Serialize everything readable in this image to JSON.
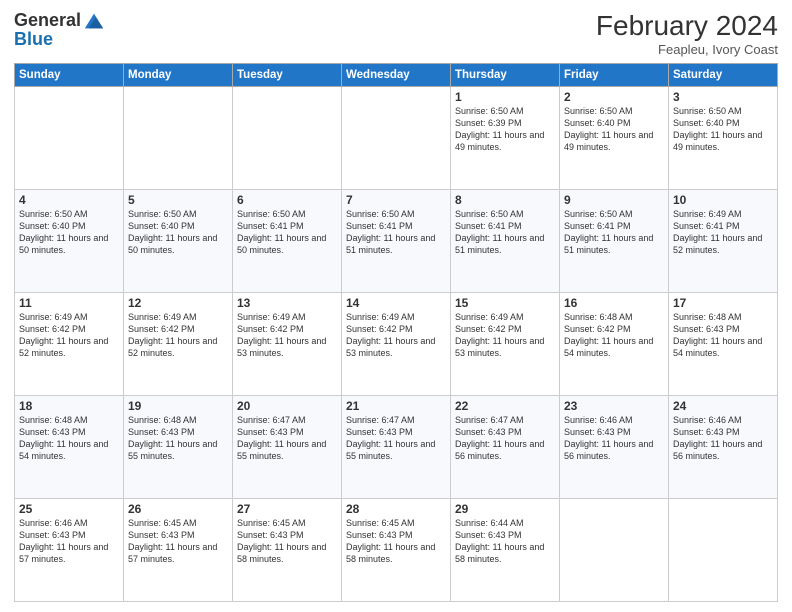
{
  "header": {
    "logo_general": "General",
    "logo_blue": "Blue",
    "month": "February 2024",
    "location": "Feapleu, Ivory Coast"
  },
  "days_of_week": [
    "Sunday",
    "Monday",
    "Tuesday",
    "Wednesday",
    "Thursday",
    "Friday",
    "Saturday"
  ],
  "weeks": [
    [
      {
        "num": "",
        "info": ""
      },
      {
        "num": "",
        "info": ""
      },
      {
        "num": "",
        "info": ""
      },
      {
        "num": "",
        "info": ""
      },
      {
        "num": "1",
        "info": "Sunrise: 6:50 AM\nSunset: 6:39 PM\nDaylight: 11 hours and 49 minutes."
      },
      {
        "num": "2",
        "info": "Sunrise: 6:50 AM\nSunset: 6:40 PM\nDaylight: 11 hours and 49 minutes."
      },
      {
        "num": "3",
        "info": "Sunrise: 6:50 AM\nSunset: 6:40 PM\nDaylight: 11 hours and 49 minutes."
      }
    ],
    [
      {
        "num": "4",
        "info": "Sunrise: 6:50 AM\nSunset: 6:40 PM\nDaylight: 11 hours and 50 minutes."
      },
      {
        "num": "5",
        "info": "Sunrise: 6:50 AM\nSunset: 6:40 PM\nDaylight: 11 hours and 50 minutes."
      },
      {
        "num": "6",
        "info": "Sunrise: 6:50 AM\nSunset: 6:41 PM\nDaylight: 11 hours and 50 minutes."
      },
      {
        "num": "7",
        "info": "Sunrise: 6:50 AM\nSunset: 6:41 PM\nDaylight: 11 hours and 51 minutes."
      },
      {
        "num": "8",
        "info": "Sunrise: 6:50 AM\nSunset: 6:41 PM\nDaylight: 11 hours and 51 minutes."
      },
      {
        "num": "9",
        "info": "Sunrise: 6:50 AM\nSunset: 6:41 PM\nDaylight: 11 hours and 51 minutes."
      },
      {
        "num": "10",
        "info": "Sunrise: 6:49 AM\nSunset: 6:41 PM\nDaylight: 11 hours and 52 minutes."
      }
    ],
    [
      {
        "num": "11",
        "info": "Sunrise: 6:49 AM\nSunset: 6:42 PM\nDaylight: 11 hours and 52 minutes."
      },
      {
        "num": "12",
        "info": "Sunrise: 6:49 AM\nSunset: 6:42 PM\nDaylight: 11 hours and 52 minutes."
      },
      {
        "num": "13",
        "info": "Sunrise: 6:49 AM\nSunset: 6:42 PM\nDaylight: 11 hours and 53 minutes."
      },
      {
        "num": "14",
        "info": "Sunrise: 6:49 AM\nSunset: 6:42 PM\nDaylight: 11 hours and 53 minutes."
      },
      {
        "num": "15",
        "info": "Sunrise: 6:49 AM\nSunset: 6:42 PM\nDaylight: 11 hours and 53 minutes."
      },
      {
        "num": "16",
        "info": "Sunrise: 6:48 AM\nSunset: 6:42 PM\nDaylight: 11 hours and 54 minutes."
      },
      {
        "num": "17",
        "info": "Sunrise: 6:48 AM\nSunset: 6:43 PM\nDaylight: 11 hours and 54 minutes."
      }
    ],
    [
      {
        "num": "18",
        "info": "Sunrise: 6:48 AM\nSunset: 6:43 PM\nDaylight: 11 hours and 54 minutes."
      },
      {
        "num": "19",
        "info": "Sunrise: 6:48 AM\nSunset: 6:43 PM\nDaylight: 11 hours and 55 minutes."
      },
      {
        "num": "20",
        "info": "Sunrise: 6:47 AM\nSunset: 6:43 PM\nDaylight: 11 hours and 55 minutes."
      },
      {
        "num": "21",
        "info": "Sunrise: 6:47 AM\nSunset: 6:43 PM\nDaylight: 11 hours and 55 minutes."
      },
      {
        "num": "22",
        "info": "Sunrise: 6:47 AM\nSunset: 6:43 PM\nDaylight: 11 hours and 56 minutes."
      },
      {
        "num": "23",
        "info": "Sunrise: 6:46 AM\nSunset: 6:43 PM\nDaylight: 11 hours and 56 minutes."
      },
      {
        "num": "24",
        "info": "Sunrise: 6:46 AM\nSunset: 6:43 PM\nDaylight: 11 hours and 56 minutes."
      }
    ],
    [
      {
        "num": "25",
        "info": "Sunrise: 6:46 AM\nSunset: 6:43 PM\nDaylight: 11 hours and 57 minutes."
      },
      {
        "num": "26",
        "info": "Sunrise: 6:45 AM\nSunset: 6:43 PM\nDaylight: 11 hours and 57 minutes."
      },
      {
        "num": "27",
        "info": "Sunrise: 6:45 AM\nSunset: 6:43 PM\nDaylight: 11 hours and 58 minutes."
      },
      {
        "num": "28",
        "info": "Sunrise: 6:45 AM\nSunset: 6:43 PM\nDaylight: 11 hours and 58 minutes."
      },
      {
        "num": "29",
        "info": "Sunrise: 6:44 AM\nSunset: 6:43 PM\nDaylight: 11 hours and 58 minutes."
      },
      {
        "num": "",
        "info": ""
      },
      {
        "num": "",
        "info": ""
      }
    ]
  ]
}
